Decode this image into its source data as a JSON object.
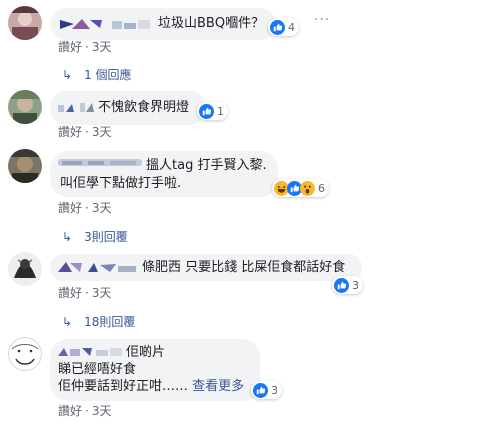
{
  "comments": [
    {
      "text": "垃圾山BBQ嗰件？",
      "reaction_count": "4",
      "like_label": "讚好",
      "time": "3天",
      "replies_label": "1 個回應"
    },
    {
      "text": "不愧飲食界明燈",
      "reaction_count": "1",
      "like_label": "讚好",
      "time": "3天"
    },
    {
      "line1": "搵人tag 打手賢入黎.",
      "line2": "叫佢學下點做打手啦.",
      "reaction_count": "6",
      "like_label": "讚好",
      "time": "3天",
      "replies_label": "3則回覆"
    },
    {
      "text": "條肥西 只要比錢 比屎佢食都話好食",
      "reaction_count": "3",
      "like_label": "讚好",
      "time": "3天",
      "replies_label": "18則回覆"
    },
    {
      "line1": "佢啲片",
      "line2": "睇已經唔好食",
      "line3": "佢仲要話到好正咁……",
      "see_more": "查看更多",
      "reaction_count": "3",
      "like_label": "讚好",
      "time": "3天"
    }
  ],
  "more_options": "···",
  "dot": "·",
  "reply_arrow": "↳",
  "colors": {
    "bubble": "#f2f3f5",
    "link": "#385898",
    "meta": "#606770",
    "like_blue": "#1877f2"
  }
}
